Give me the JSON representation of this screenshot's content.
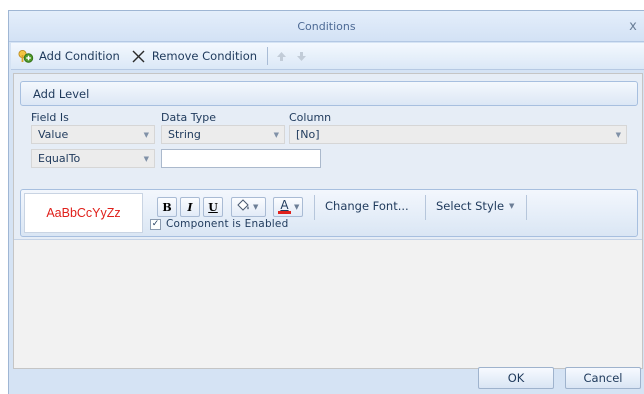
{
  "window": {
    "title": "Conditions",
    "close_glyph": "x"
  },
  "toolbar": {
    "add_label": "Add Condition",
    "remove_label": "Remove Condition",
    "add_icon": "add-condition-icon",
    "remove_icon": "remove-x-icon",
    "up_icon": "move-up-icon",
    "down_icon": "move-down-icon"
  },
  "condition": {
    "level_label": "Add Level",
    "headers": {
      "field_is": "Field Is",
      "data_type": "Data Type",
      "column": "Column"
    },
    "field_is_value": "Value",
    "data_type_value": "String",
    "column_value": "[No]",
    "operator_value": "EqualTo",
    "operand_value": ""
  },
  "style": {
    "preview_text": "AaBbCcYyZz",
    "bold_label": "B",
    "italic_label": "I",
    "underline_label": "U",
    "font_color_label": "A",
    "change_font_label": "Change Font...",
    "select_style_label": "Select Style",
    "enabled_label": "Component is Enabled",
    "enabled_checked": "✓"
  },
  "dialog": {
    "ok_label": "OK",
    "cancel_label": "Cancel"
  },
  "colors": {
    "preview_text": "#e0201b",
    "font_color_bar": "#e0201b",
    "accent": "#1e395b"
  }
}
